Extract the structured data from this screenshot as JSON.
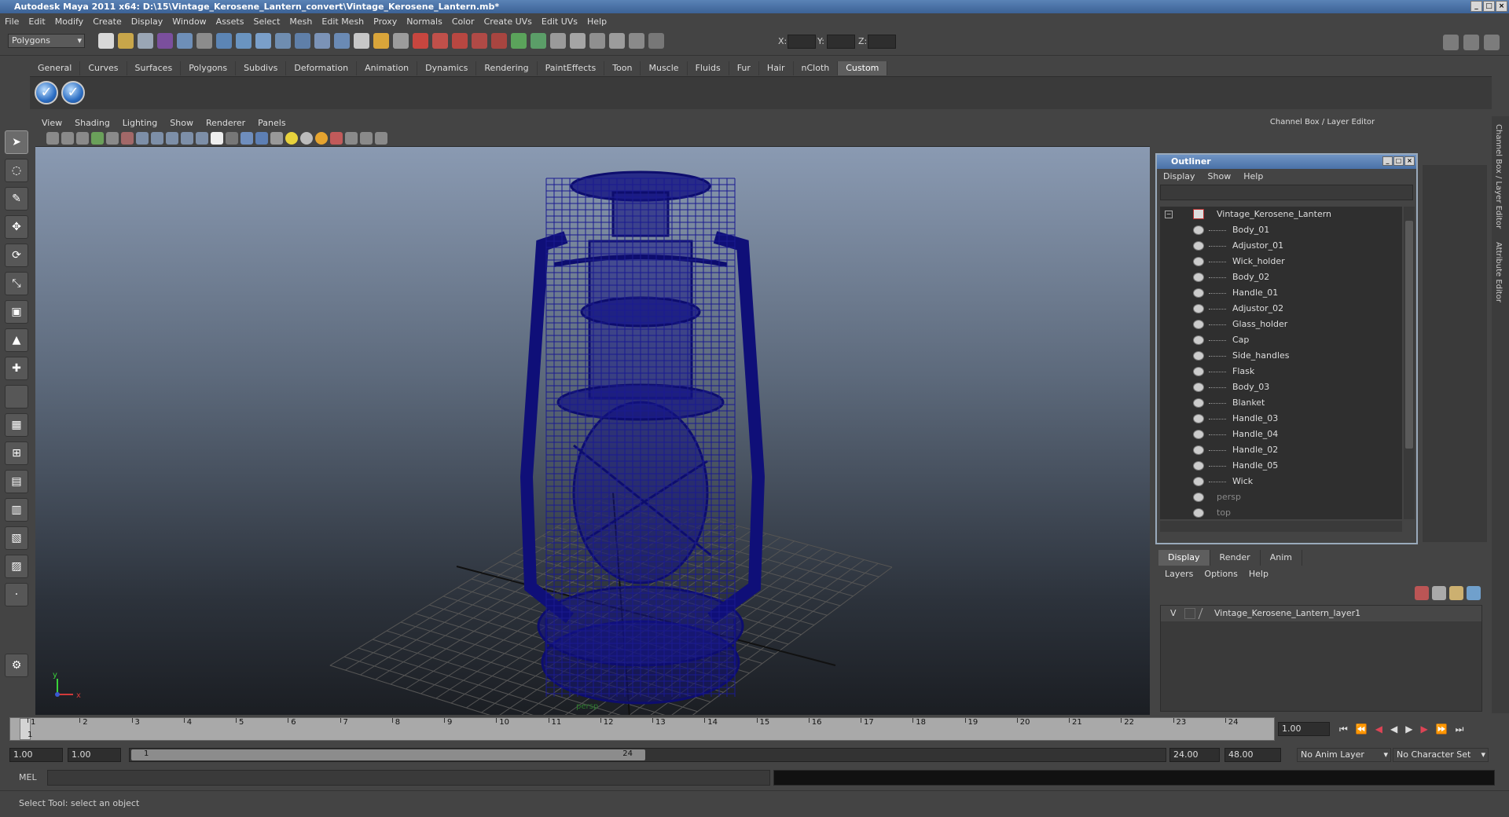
{
  "window": {
    "title": "Autodesk Maya 2011 x64: D:\\15\\Vintage_Kerosene_Lantern_convert\\Vintage_Kerosene_Lantern.mb*"
  },
  "menu": [
    "File",
    "Edit",
    "Modify",
    "Create",
    "Display",
    "Window",
    "Assets",
    "Select",
    "Mesh",
    "Edit Mesh",
    "Proxy",
    "Normals",
    "Color",
    "Create UVs",
    "Edit UVs",
    "Help"
  ],
  "status": {
    "mode": "Polygons",
    "x_label": "X:",
    "y_label": "Y:",
    "z_label": "Z:"
  },
  "shelf_tabs": [
    "General",
    "Curves",
    "Surfaces",
    "Polygons",
    "Subdivs",
    "Deformation",
    "Animation",
    "Dynamics",
    "Rendering",
    "PaintEffects",
    "Toon",
    "Muscle",
    "Fluids",
    "Fur",
    "Hair",
    "nCloth",
    "Custom"
  ],
  "shelf_active": "Custom",
  "viewport": {
    "menu": [
      "View",
      "Shading",
      "Lighting",
      "Show",
      "Renderer",
      "Panels"
    ],
    "camera_label": "persp",
    "axis_x": "x",
    "axis_y": "y"
  },
  "channel_box": {
    "title": "Channel Box / Layer Editor"
  },
  "outliner": {
    "title": "Outliner",
    "menu": [
      "Display",
      "Show",
      "Help"
    ],
    "root": "Vintage_Kerosene_Lantern",
    "children": [
      "Body_01",
      "Adjustor_01",
      "Wick_holder",
      "Body_02",
      "Handle_01",
      "Adjustor_02",
      "Glass_holder",
      "Cap",
      "Side_handles",
      "Flask",
      "Body_03",
      "Blanket",
      "Handle_03",
      "Handle_04",
      "Handle_02",
      "Handle_05",
      "Wick"
    ],
    "cameras": [
      "persp",
      "top"
    ]
  },
  "layer_editor": {
    "tabs": [
      "Display",
      "Render",
      "Anim"
    ],
    "menu": [
      "Layers",
      "Options",
      "Help"
    ],
    "layer_visibility": "V",
    "layer_name": "Vintage_Kerosene_Lantern_layer1"
  },
  "side_tabs": [
    "Channel Box / Layer Editor",
    "Attribute Editor"
  ],
  "timeline": {
    "ticks": [
      "1",
      "2",
      "3",
      "4",
      "5",
      "6",
      "7",
      "8",
      "9",
      "10",
      "11",
      "12",
      "13",
      "14",
      "15",
      "16",
      "17",
      "18",
      "19",
      "20",
      "21",
      "22",
      "23",
      "24"
    ],
    "current": "1",
    "current_field": "1.00"
  },
  "range": {
    "start": "1.00",
    "playback_start": "1.00",
    "slider_start": "1",
    "slider_end": "24",
    "playback_end": "24.00",
    "end": "48.00",
    "anim_layer": "No Anim Layer",
    "char_set": "No Character Set"
  },
  "cmd": {
    "label": "MEL"
  },
  "help": {
    "text": "Select Tool: select an object"
  },
  "colors": {
    "wire": "#0d0d6e",
    "title_bar": "#4a71a7"
  }
}
